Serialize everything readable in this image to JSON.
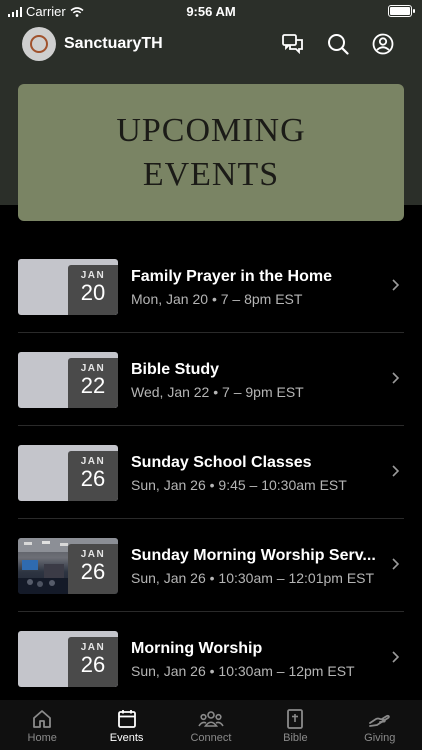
{
  "status_bar": {
    "carrier": "Carrier",
    "time": "9:56 AM"
  },
  "app_bar": {
    "title": "SanctuaryTH"
  },
  "banner": {
    "line1": "UPCOMING",
    "line2": "EVENTS"
  },
  "events": [
    {
      "month": "JAN",
      "day": "20",
      "title": "Family Prayer in the Home",
      "time": "Mon, Jan 20 • 7 – 8pm EST",
      "thumbnail": "blank"
    },
    {
      "month": "JAN",
      "day": "22",
      "title": "Bible Study",
      "time": "Wed, Jan 22 • 7 – 9pm EST",
      "thumbnail": "blank"
    },
    {
      "month": "JAN",
      "day": "26",
      "title": "Sunday School Classes",
      "time": "Sun, Jan 26 • 9:45 – 10:30am EST",
      "thumbnail": "blank"
    },
    {
      "month": "JAN",
      "day": "26",
      "title": "Sunday Morning Worship Serv...",
      "time": "Sun, Jan 26 • 10:30am – 12:01pm EST",
      "thumbnail": "photo"
    },
    {
      "month": "JAN",
      "day": "26",
      "title": "Morning Worship",
      "time": "Sun, Jan 26 • 10:30am – 12pm EST",
      "thumbnail": "blank"
    }
  ],
  "tabs": [
    {
      "label": "Home",
      "icon": "home-icon",
      "active": false
    },
    {
      "label": "Events",
      "icon": "calendar-icon",
      "active": true
    },
    {
      "label": "Connect",
      "icon": "people-icon",
      "active": false
    },
    {
      "label": "Bible",
      "icon": "bible-icon",
      "active": false
    },
    {
      "label": "Giving",
      "icon": "giving-hand-icon",
      "active": false
    }
  ],
  "colors": {
    "header_bg": "#2b2f29",
    "banner_bg": "#7a8464",
    "badge_bg": "#4a4a4a",
    "thumb_bg": "#c4c5cb"
  }
}
